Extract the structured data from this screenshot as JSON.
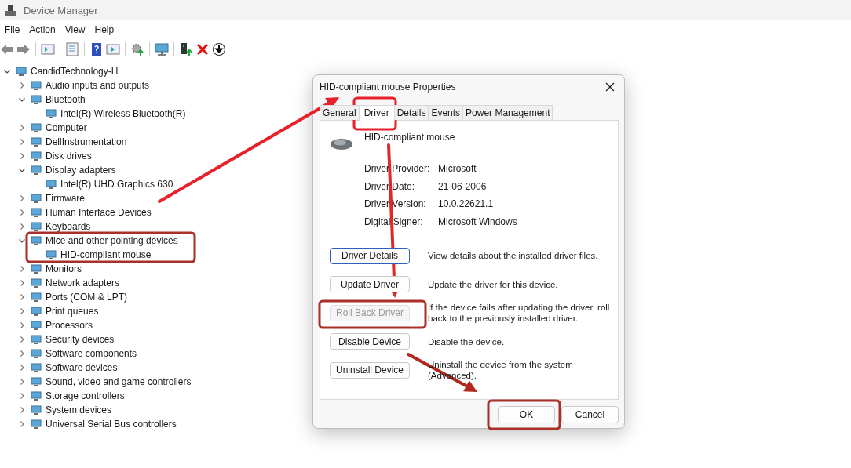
{
  "window": {
    "title": "Device Manager"
  },
  "menu": [
    "File",
    "Action",
    "View",
    "Help"
  ],
  "tree": {
    "label": "CandidTechnology-H",
    "expanded": true,
    "children": [
      {
        "label": "Audio inputs and outputs",
        "expanded": false
      },
      {
        "label": "Bluetooth",
        "expanded": true,
        "children": [
          {
            "label": "Intel(R) Wireless Bluetooth(R)"
          }
        ]
      },
      {
        "label": "Computer",
        "expanded": false
      },
      {
        "label": "DellInstrumentation",
        "expanded": false
      },
      {
        "label": "Disk drives",
        "expanded": false
      },
      {
        "label": "Display adapters",
        "expanded": true,
        "children": [
          {
            "label": "Intel(R) UHD Graphics 630"
          }
        ]
      },
      {
        "label": "Firmware",
        "expanded": false
      },
      {
        "label": "Human Interface Devices",
        "expanded": false
      },
      {
        "label": "Keyboards",
        "expanded": false
      },
      {
        "label": "Mice and other pointing devices",
        "expanded": true,
        "children": [
          {
            "label": "HID-compliant mouse"
          }
        ]
      },
      {
        "label": "Monitors",
        "expanded": false
      },
      {
        "label": "Network adapters",
        "expanded": false
      },
      {
        "label": "Ports (COM & LPT)",
        "expanded": false
      },
      {
        "label": "Print queues",
        "expanded": false
      },
      {
        "label": "Processors",
        "expanded": false
      },
      {
        "label": "Security devices",
        "expanded": false
      },
      {
        "label": "Software components",
        "expanded": false
      },
      {
        "label": "Software devices",
        "expanded": false
      },
      {
        "label": "Sound, video and game controllers",
        "expanded": false
      },
      {
        "label": "Storage controllers",
        "expanded": false
      },
      {
        "label": "System devices",
        "expanded": false
      },
      {
        "label": "Universal Serial Bus controllers",
        "expanded": false
      }
    ]
  },
  "dialog": {
    "title": "HID-compliant mouse Properties",
    "tabs": [
      {
        "label": "General",
        "selected": false
      },
      {
        "label": "Driver",
        "selected": true
      },
      {
        "label": "Details",
        "selected": false
      },
      {
        "label": "Events",
        "selected": false
      },
      {
        "label": "Power Management",
        "selected": false
      }
    ],
    "device_name": "HID-compliant mouse",
    "info": [
      {
        "label": "Driver Provider:",
        "value": "Microsoft"
      },
      {
        "label": "Driver Date:",
        "value": "21-06-2006"
      },
      {
        "label": "Driver Version:",
        "value": "10.0.22621.1"
      },
      {
        "label": "Digital Signer:",
        "value": "Microsoft Windows"
      }
    ],
    "actions": [
      {
        "label": "Driver Details",
        "description": "View details about the installed driver files.",
        "disabled": false,
        "focused": true
      },
      {
        "label": "Update Driver",
        "description": "Update the driver for this device.",
        "disabled": false,
        "focused": false
      },
      {
        "label": "Roll Back Driver",
        "description": "If the device fails after updating the driver, roll back to the previously installed driver.",
        "disabled": true,
        "focused": false
      },
      {
        "label": "Disable Device",
        "description": "Disable the device.",
        "disabled": false,
        "focused": false
      },
      {
        "label": "Uninstall Device",
        "description": "Uninstall the device from the system (Advanced).",
        "disabled": false,
        "focused": false
      }
    ],
    "buttons": [
      {
        "label": "OK"
      },
      {
        "label": "Cancel"
      }
    ]
  }
}
